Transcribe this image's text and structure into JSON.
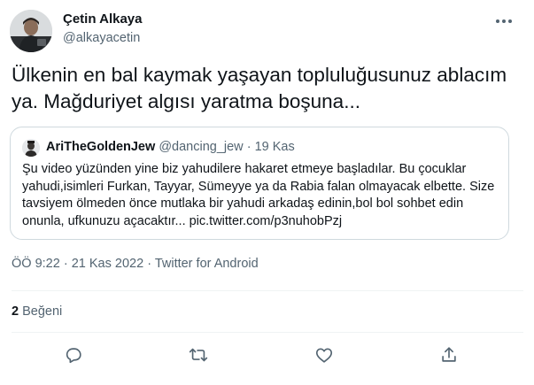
{
  "author": {
    "name": "Çetin Alkaya",
    "handle": "@alkayacetin"
  },
  "tweet": {
    "text": "Ülkenin en bal kaymak yaşayan topluluğusunuz ablacım ya. Mağduriyet algısı yaratma boşuna..."
  },
  "quote": {
    "name": "AriTheGoldenJew",
    "handle": "@dancing_jew",
    "separator": "·",
    "date": "19 Kas",
    "text": "Şu video yüzünden yine biz yahudilere hakaret etmeye başladılar. Bu çocuklar yahudi,isimleri Furkan, Tayyar, Sümeyye ya da Rabia falan olmayacak elbette. Size tavsiyem ölmeden önce mutlaka bir yahudi arkadaş edinin,bol bol sohbet edin onunla, ufkunuzu açacaktır... pic.twitter.com/p3nuhobPzj"
  },
  "meta": {
    "time": "ÖÖ 9:22",
    "separator1": "·",
    "date": "21 Kas 2022",
    "separator2": "·",
    "source": "Twitter for Android"
  },
  "stats": {
    "likes_count": "2",
    "likes_label": "Beğeni"
  },
  "actions": [
    {
      "icon": "reply-icon"
    },
    {
      "icon": "retweet-icon"
    },
    {
      "icon": "like-icon"
    },
    {
      "icon": "share-icon"
    }
  ],
  "colors": {
    "text_primary": "#0f1419",
    "text_secondary": "#536471",
    "border": "#cfd9de",
    "divider": "#eff3f4"
  }
}
